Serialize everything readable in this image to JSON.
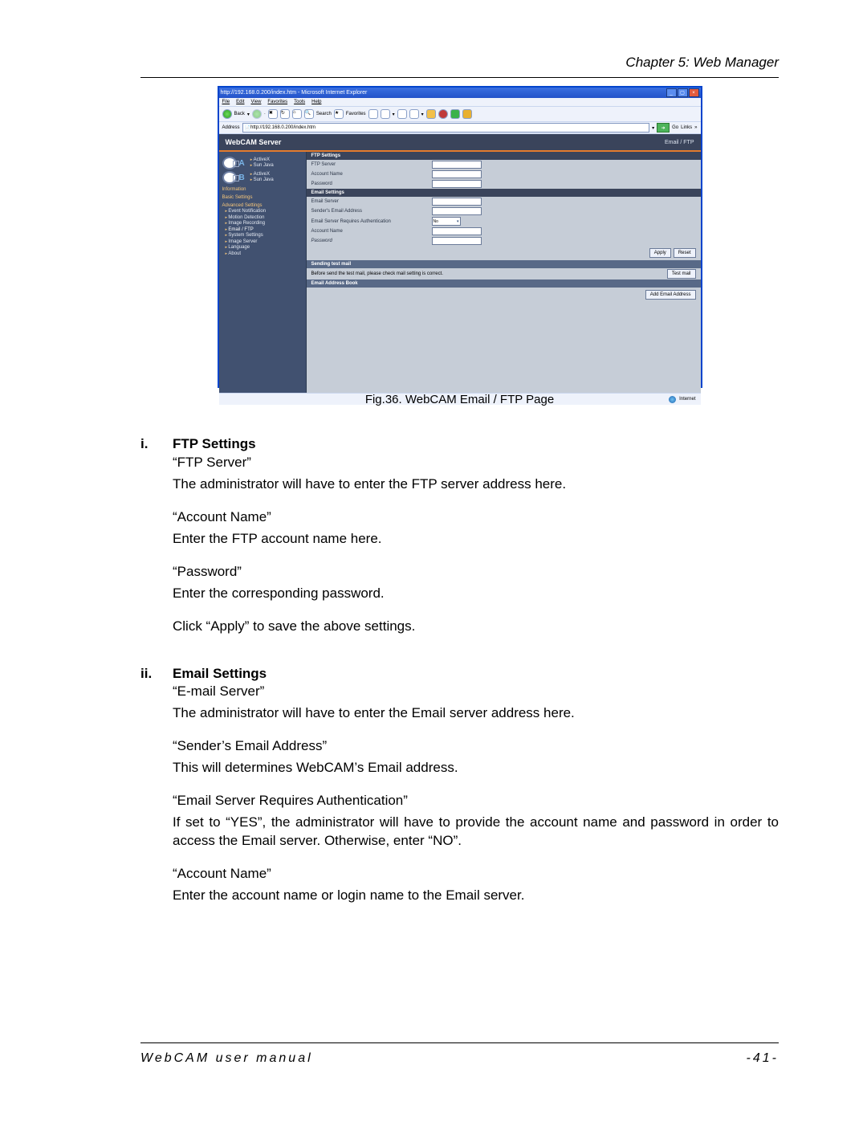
{
  "header": {
    "chapter": "Chapter 5: Web Manager"
  },
  "figure": {
    "caption": "Fig.36.  WebCAM Email / FTP Page"
  },
  "footer": {
    "manual": "WebCAM user manual",
    "page": "-41-"
  },
  "ie": {
    "title": "http://192.168.0.200/index.htm - Microsoft Internet Explorer",
    "menu": {
      "file": "File",
      "edit": "Edit",
      "view": "View",
      "favorites": "Favorites",
      "tools": "Tools",
      "help": "Help"
    },
    "toolbar": {
      "back": "Back",
      "search": "Search",
      "favorites": "Favorites"
    },
    "address": {
      "label": "Address",
      "url": "http://192.168.0.200/index.htm",
      "go": "Go",
      "links": "Links"
    },
    "status": {
      "zone": "Internet"
    }
  },
  "webcam": {
    "title": "WebCAM Server",
    "breadcrumb": "Email / FTP",
    "cam_a": {
      "letter": "A",
      "ax": "ActiveX",
      "java": "Sun Java"
    },
    "cam_b": {
      "letter": "B",
      "ax": "ActiveX",
      "java": "Sun Java"
    },
    "nav": {
      "info": "Information",
      "basic": "Basic Settings",
      "adv": "Advanced Settings",
      "event": "Event Notification",
      "motion": "Motion Detection",
      "recording": "Image Recording",
      "emailftp": "Email / FTP",
      "sys": "System Settings",
      "imgsrv": "Image Server",
      "lang": "Language",
      "about": "About"
    },
    "form": {
      "ftp_section": "FTP Settings",
      "ftp_server": "FTP Server",
      "ftp_account": "Account Name",
      "ftp_password": "Password",
      "email_section": "Email Settings",
      "email_server": "Email Server",
      "sender": "Sender's Email Address",
      "auth": "Email Server Requires Authentication",
      "auth_value": "No",
      "e_account": "Account Name",
      "e_password": "Password",
      "apply": "Apply",
      "reset": "Reset",
      "sendtest_section": "Sending test mail",
      "sendtest_note": "Before send the test mail, please check mail setting is correct.",
      "testmail": "Test mail",
      "addrbook_section": "Email Address Book",
      "addemail": "Add Email Address"
    }
  },
  "sections": {
    "s1": {
      "num": "i.",
      "title": "FTP Settings",
      "p1a": "“FTP Server”",
      "p1b": "The administrator will have to enter the FTP server address here.",
      "p2a": "“Account Name”",
      "p2b": "Enter the FTP account name here.",
      "p3a": "“Password”",
      "p3b": "Enter the corresponding password.",
      "p4": "Click “Apply” to save the above settings."
    },
    "s2": {
      "num": "ii.",
      "title": "Email Settings",
      "p1a": "“E-mail Server”",
      "p1b": "The administrator will have to enter the Email server address here.",
      "p2a": "“Sender’s Email Address”",
      "p2b": "This will determines WebCAM’s Email address.",
      "p3a": "“Email Server Requires Authentication”",
      "p3b": "If set to “YES”, the administrator will have to provide the account name and password in order to access the Email server.   Otherwise, enter “NO”.",
      "p4a": "“Account Name”",
      "p4b": "Enter the account name or login name to the Email server."
    }
  }
}
